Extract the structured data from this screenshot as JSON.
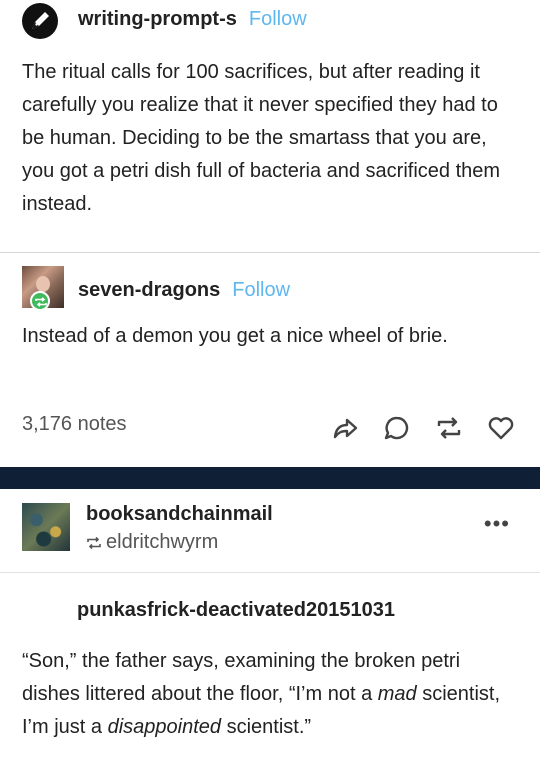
{
  "post1": {
    "username": "writing-prompt-s",
    "follow_label": "Follow",
    "body": "The ritual calls for 100 sacrifices, but after reading it carefully you realize that it never specified they had to be human. Deciding to be the smartass that you are, you got a petri dish full of bacteria and sacrificed them instead."
  },
  "post2": {
    "username": "seven-dragons",
    "follow_label": "Follow",
    "body": "Instead of a demon you get a nice wheel of brie.",
    "notes": "3,176 notes"
  },
  "post3": {
    "username": "booksandchainmail",
    "reblogged_from": "eldritchwyrm",
    "more_label": "•••",
    "quote_username": "punkasfrick-deactivated20151031",
    "body_parts": [
      "“Son,” the father says, examining the broken petri dishes littered about the floor, “I’m not a ",
      "mad",
      " scientist, I’m just a ",
      "disappointed",
      " scientist.”"
    ]
  },
  "colors": {
    "follow": "#5fb7ef",
    "dark_bar": "#0f1f35",
    "reblog_badge": "#3fba5d"
  },
  "icons": [
    "pen-icon",
    "share-icon",
    "reply-icon",
    "reblog-icon",
    "heart-icon",
    "more-icon"
  ]
}
